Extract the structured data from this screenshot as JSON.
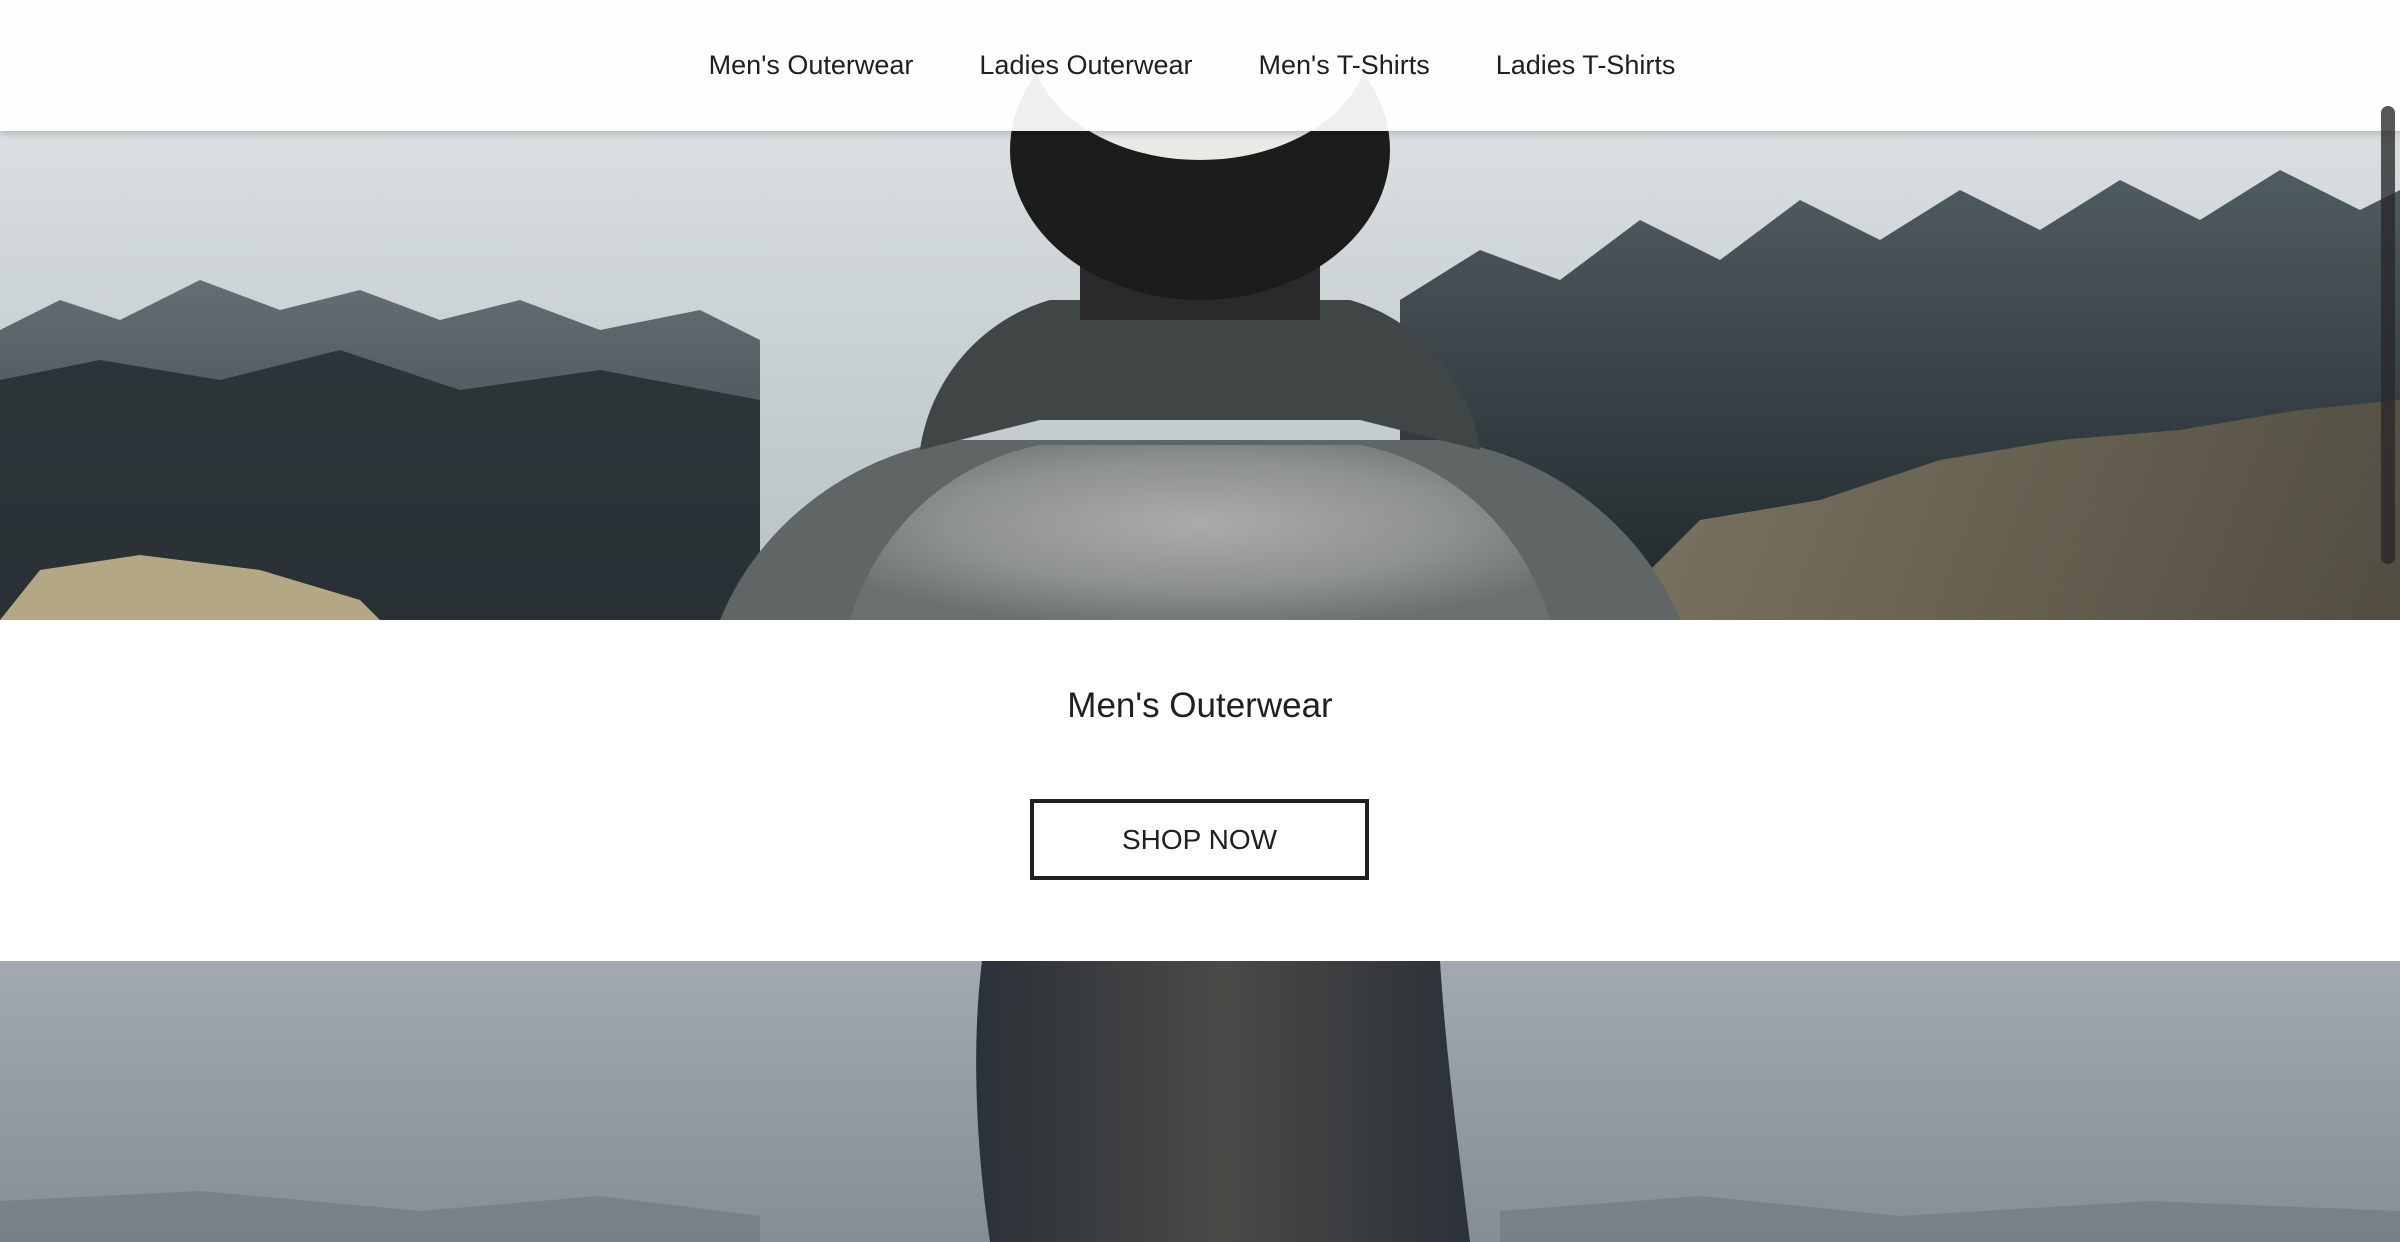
{
  "nav": {
    "items": [
      {
        "label": "Men's Outerwear"
      },
      {
        "label": "Ladies Outerwear"
      },
      {
        "label": "Men's T-Shirts"
      },
      {
        "label": "Ladies T-Shirts"
      }
    ]
  },
  "featured": {
    "title": "Men's Outerwear",
    "button_label": "SHOP NOW"
  },
  "images": {
    "hero": "man-in-grey-knit-jacket-facing-misty-forest",
    "second": "person-in-dark-knit-sweater-foggy-sky"
  },
  "colors": {
    "text": "#202020",
    "button_border": "#202020",
    "header_bg": "#ffffff"
  }
}
